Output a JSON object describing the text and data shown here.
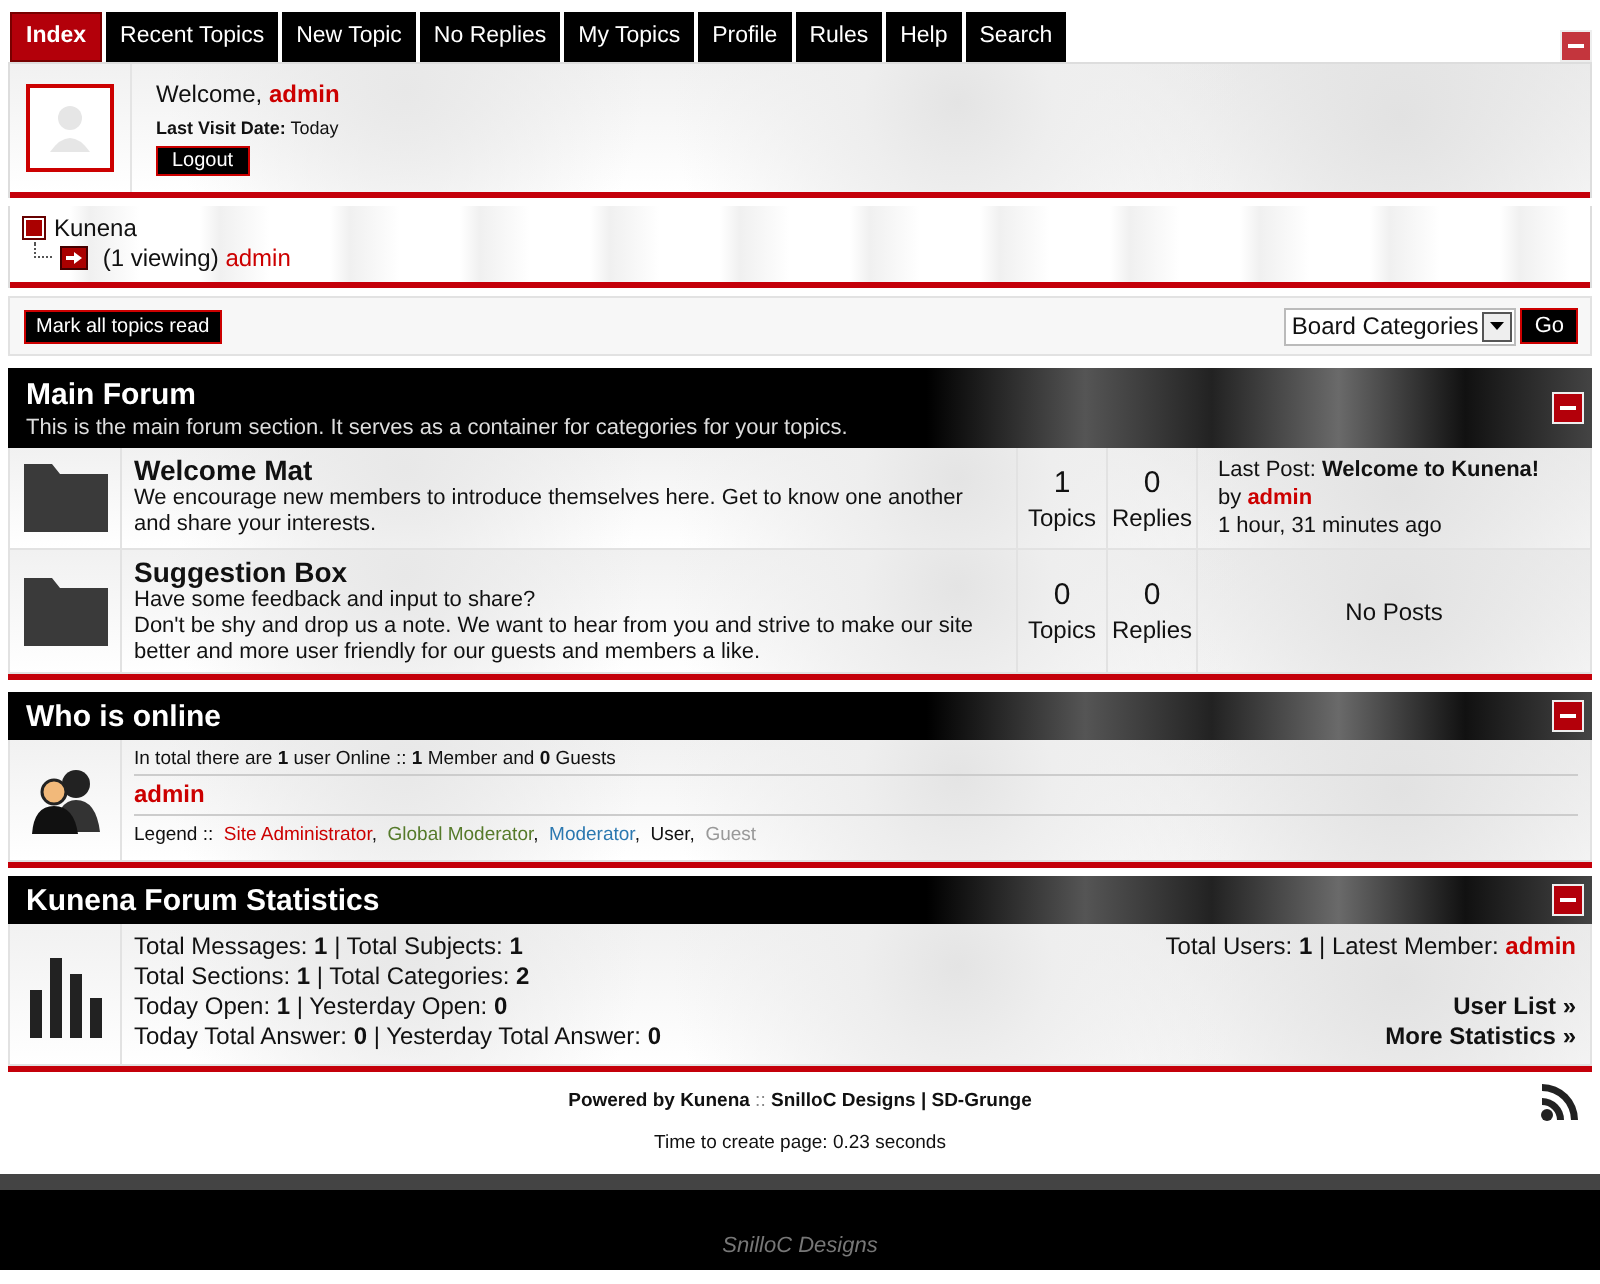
{
  "tabs": [
    {
      "label": "Index",
      "selected": true
    },
    {
      "label": "Recent Topics",
      "selected": false
    },
    {
      "label": "New Topic",
      "selected": false
    },
    {
      "label": "No Replies",
      "selected": false
    },
    {
      "label": "My Topics",
      "selected": false
    },
    {
      "label": "Profile",
      "selected": false
    },
    {
      "label": "Rules",
      "selected": false
    },
    {
      "label": "Help",
      "selected": false
    },
    {
      "label": "Search",
      "selected": false
    }
  ],
  "profile": {
    "welcome": "Welcome,",
    "username": "admin",
    "last_visit_label": "Last Visit Date:",
    "last_visit": "Today",
    "logout": "Logout"
  },
  "breadcrumb": {
    "root": "Kunena",
    "viewing": "(1 viewing)",
    "viewer": "admin"
  },
  "toolbar": {
    "mark_read": "Mark all topics read",
    "jump_select": "Board Categories",
    "go": "Go"
  },
  "main_forum": {
    "title": "Main Forum",
    "description": "This is the main forum section. It serves as a container for categories for your topics.",
    "forums": [
      {
        "name": "Welcome Mat",
        "description": [
          "We encourage new members to introduce themselves here. Get to know one another and share your interests."
        ],
        "topics": "1",
        "topics_label": "Topics",
        "replies": "0",
        "replies_label": "Replies",
        "last_post": {
          "kind": "post",
          "label": "Last Post:",
          "subject": "Welcome to Kunena!",
          "by": "by",
          "author": "admin",
          "time": "1 hour, 31 minutes ago"
        }
      },
      {
        "name": "Suggestion Box",
        "description": [
          "Have some feedback and input to share?",
          "Don't be shy and drop us a note. We want to hear from you and strive to make our site better and more user friendly for our guests and members a like."
        ],
        "topics": "0",
        "topics_label": "Topics",
        "replies": "0",
        "replies_label": "Replies",
        "last_post": {
          "kind": "none",
          "text": "No Posts"
        }
      }
    ]
  },
  "who_is_online": {
    "title": "Who is online",
    "summary": "In total there are **1** user Online  ::  **1** Member and **0** Guests",
    "users": [
      "admin"
    ],
    "legend_label": "Legend ::",
    "legend_separator": ",",
    "legend": [
      {
        "label": "Site Administrator",
        "color": "#cc0000"
      },
      {
        "label": "Global Moderator",
        "color": "#557a2a"
      },
      {
        "label": "Moderator",
        "color": "#2b78b0"
      },
      {
        "label": "User",
        "color": "#111111"
      },
      {
        "label": "Guest",
        "color": "#999999"
      }
    ]
  },
  "stats": {
    "title": "Kunena Forum Statistics",
    "lines": [
      "Total Messages: **1**  |  Total Subjects: **1**",
      "Total Sections: **1**  |  Total Categories: **2**",
      "Today Open: **1**  |  Yesterday Open: **0**",
      "Today Total Answer: **0**  |  Yesterday Total Answer: **0**"
    ],
    "users_line": "Total Users: **1**  |  Latest Member:",
    "latest_member": "admin",
    "links": [
      "User List »",
      "More Statistics »"
    ]
  },
  "footer": {
    "powered": "**Powered by Kunena** :: **SnilloC Designs | SD-Grunge**",
    "time": "Time to create page: 0.23 seconds",
    "logo": "SnilloC Designs"
  }
}
